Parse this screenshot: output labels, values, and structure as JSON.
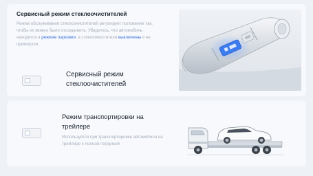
{
  "wiper": {
    "title": "Сервисный режим стеклоочистителей",
    "desc_part1": "Режим обслуживания стеклоочистителей регулирует положение так, чтобы их можно было отсоединить. Убедитесь, что автомобиль",
    "desc_part2": "находится в",
    "desc_link1": "режиме парковки",
    "desc_part3": ", а стеклоочистители",
    "desc_link2": "выключены",
    "desc_part4": "и не примерзли.",
    "toggle_label": "Сервисный режим стеклоочистителей",
    "toggle_on": false
  },
  "transport": {
    "title": "Режим транспортировки на трейлере",
    "desc": "Используется при транспортировке автомобиля на трейлере с полной погрузкой",
    "toggle_on": false
  },
  "colors": {
    "accent": "#3d72d9",
    "card": "#f7f9fc",
    "background": "#eef2f7"
  }
}
